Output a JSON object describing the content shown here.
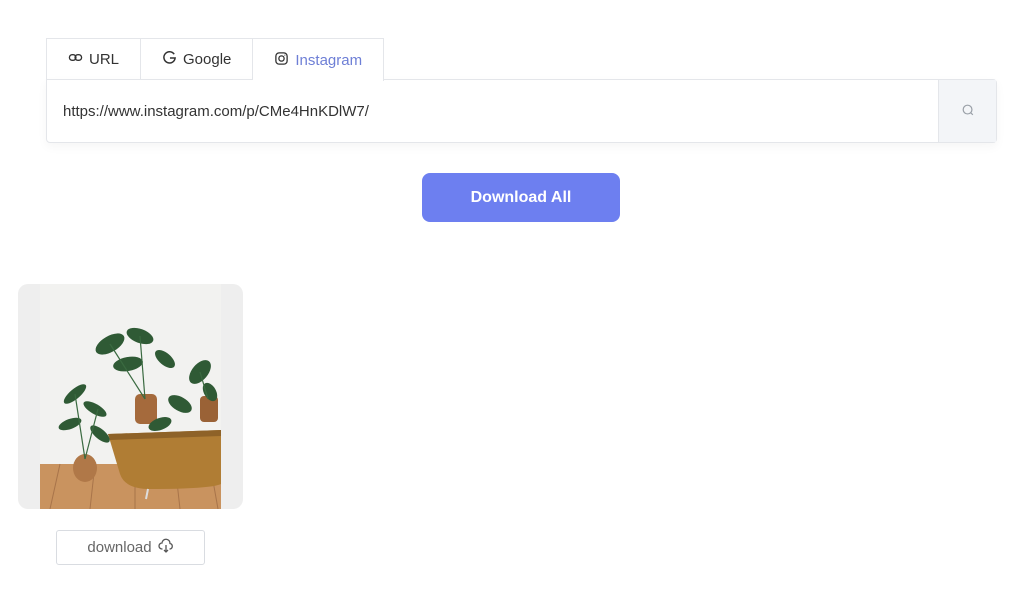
{
  "tabs": [
    {
      "label": "URL",
      "icon": "link-icon",
      "active": false
    },
    {
      "label": "Google",
      "icon": "google-icon",
      "active": false
    },
    {
      "label": "Instagram",
      "icon": "instagram-icon",
      "active": true
    }
  ],
  "search": {
    "value": "https://www.instagram.com/p/CMe4HnKDlW7/",
    "icon": "search-icon"
  },
  "actions": {
    "download_all_label": "Download All"
  },
  "results": [
    {
      "download_label": "download",
      "download_icon": "cloud-download-icon"
    }
  ],
  "colors": {
    "accent": "#6d7ff0",
    "active_tab": "#6e7fd6",
    "card_bg": "#eeeeee"
  }
}
